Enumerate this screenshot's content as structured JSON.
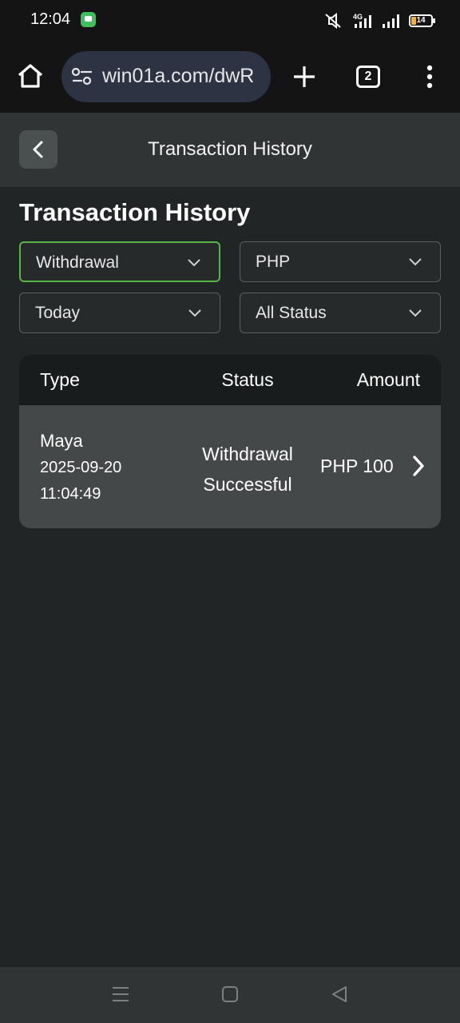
{
  "status_bar": {
    "time": "12:04",
    "network": "4G",
    "battery": "14",
    "icons": [
      "message-icon",
      "mute-icon",
      "signal-4g-icon",
      "signal-icon",
      "battery-icon"
    ]
  },
  "browser": {
    "url": "win01a.com/dwR",
    "tab_count": "2",
    "icons": [
      "home-icon",
      "site-settings-icon",
      "plus-icon",
      "tab-switcher-icon",
      "more-menu-icon"
    ]
  },
  "header": {
    "title": "Transaction History"
  },
  "section_title": "Transaction History",
  "filters": {
    "type": "Withdrawal",
    "currency": "PHP",
    "date": "Today",
    "status": "All Status"
  },
  "table": {
    "columns": [
      "Type",
      "Status",
      "Amount"
    ],
    "rows": [
      {
        "method": "Maya",
        "date": "2025-09-20",
        "time": "11:04:49",
        "status_line1": "Withdrawal",
        "status_line2": "Successful",
        "amount": "PHP 100"
      }
    ]
  },
  "colors": {
    "background": "#222526",
    "header": "#303435",
    "active_border": "#58b445",
    "row": "#444849"
  }
}
